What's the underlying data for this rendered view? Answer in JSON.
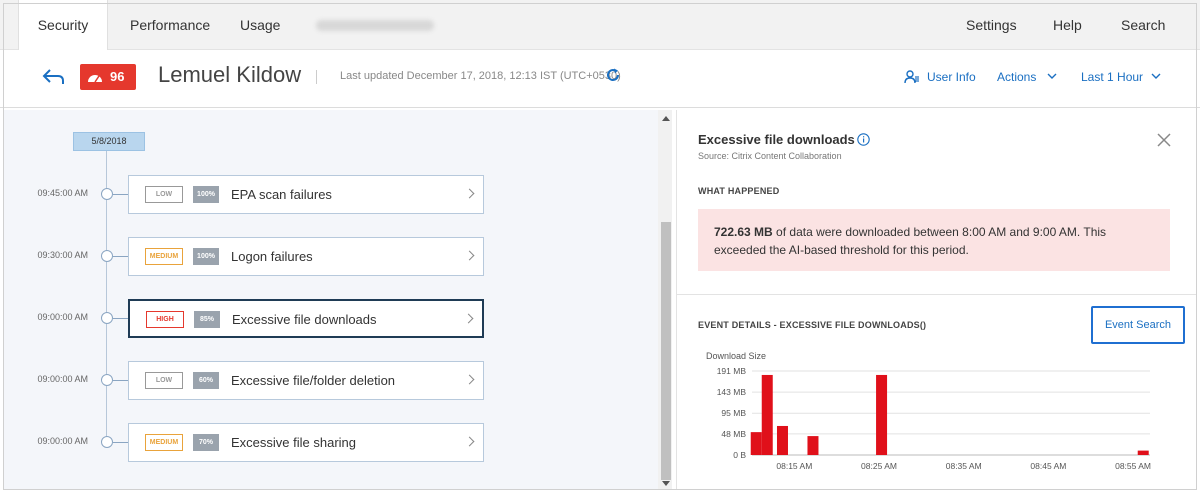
{
  "nav": {
    "tabs": [
      {
        "label": "Security",
        "active": true
      },
      {
        "label": "Performance",
        "active": false
      },
      {
        "label": "Usage",
        "active": false
      }
    ],
    "right_links": [
      "Settings",
      "Help",
      "Search"
    ]
  },
  "header": {
    "risk_score": "96",
    "user_name": "Lemuel Kildow",
    "last_updated": "Last updated December 17, 2018, 12:13 IST (UTC+0530)",
    "user_info": "User Info",
    "actions": "Actions",
    "time_range": "Last 1 Hour"
  },
  "timeline": {
    "date": "5/8/2018",
    "events": [
      {
        "time": "09:45:00 AM",
        "severity": "LOW",
        "severity_level": "low",
        "percent": "100%",
        "title": "EPA scan failures",
        "selected": false
      },
      {
        "time": "09:30:00 AM",
        "severity": "MEDIUM",
        "severity_level": "medium",
        "percent": "100%",
        "title": "Logon failures",
        "selected": false
      },
      {
        "time": "09:00:00 AM",
        "severity": "HIGH",
        "severity_level": "high",
        "percent": "85%",
        "title": "Excessive file downloads",
        "selected": true
      },
      {
        "time": "09:00:00 AM",
        "severity": "LOW",
        "severity_level": "low",
        "percent": "60%",
        "title": "Excessive file/folder deletion",
        "selected": false
      },
      {
        "time": "09:00:00 AM",
        "severity": "MEDIUM",
        "severity_level": "medium",
        "percent": "70%",
        "title": "Excessive file sharing",
        "selected": false
      }
    ]
  },
  "detail": {
    "title": "Excessive file downloads",
    "source": "Source: Citrix Content Collaboration",
    "what_happened_heading": "WHAT HAPPENED",
    "amount": "722.63 MB",
    "description": "of data were downloaded between 8:00 AM and 9:00 AM. This exceeded the AI-based threshold for this period.",
    "event_details_heading": "EVENT DETAILS - EXCESSIVE FILE DOWNLOADS()",
    "event_search": "Event Search"
  },
  "colors": {
    "accent": "#1a6fc2",
    "risk_red": "#e5382d",
    "medium_orange": "#e9a33b",
    "alert_bg": "#fbe3e3"
  },
  "chart_data": {
    "type": "bar",
    "ylabel": "Download Size",
    "y_ticks": [
      "191 MB",
      "143 MB",
      "95 MB",
      "48 MB",
      "0 B"
    ],
    "y_tick_values": [
      191,
      143,
      95,
      48,
      0
    ],
    "ylim": [
      0,
      191
    ],
    "x_ticks": [
      "08:15 AM",
      "08:25 AM",
      "08:35 AM",
      "08:45 AM",
      "08:55 AM"
    ],
    "x_tick_minutes": [
      15,
      25,
      35,
      45,
      55
    ],
    "xlim": [
      10,
      57
    ],
    "grid": true,
    "color": "#e0101a",
    "bars": [
      {
        "minute": 10.5,
        "value": 52
      },
      {
        "minute": 11.8,
        "value": 182
      },
      {
        "minute": 13.6,
        "value": 66
      },
      {
        "minute": 17.2,
        "value": 43
      },
      {
        "minute": 25.3,
        "value": 182
      },
      {
        "minute": 56.2,
        "value": 10
      }
    ]
  }
}
